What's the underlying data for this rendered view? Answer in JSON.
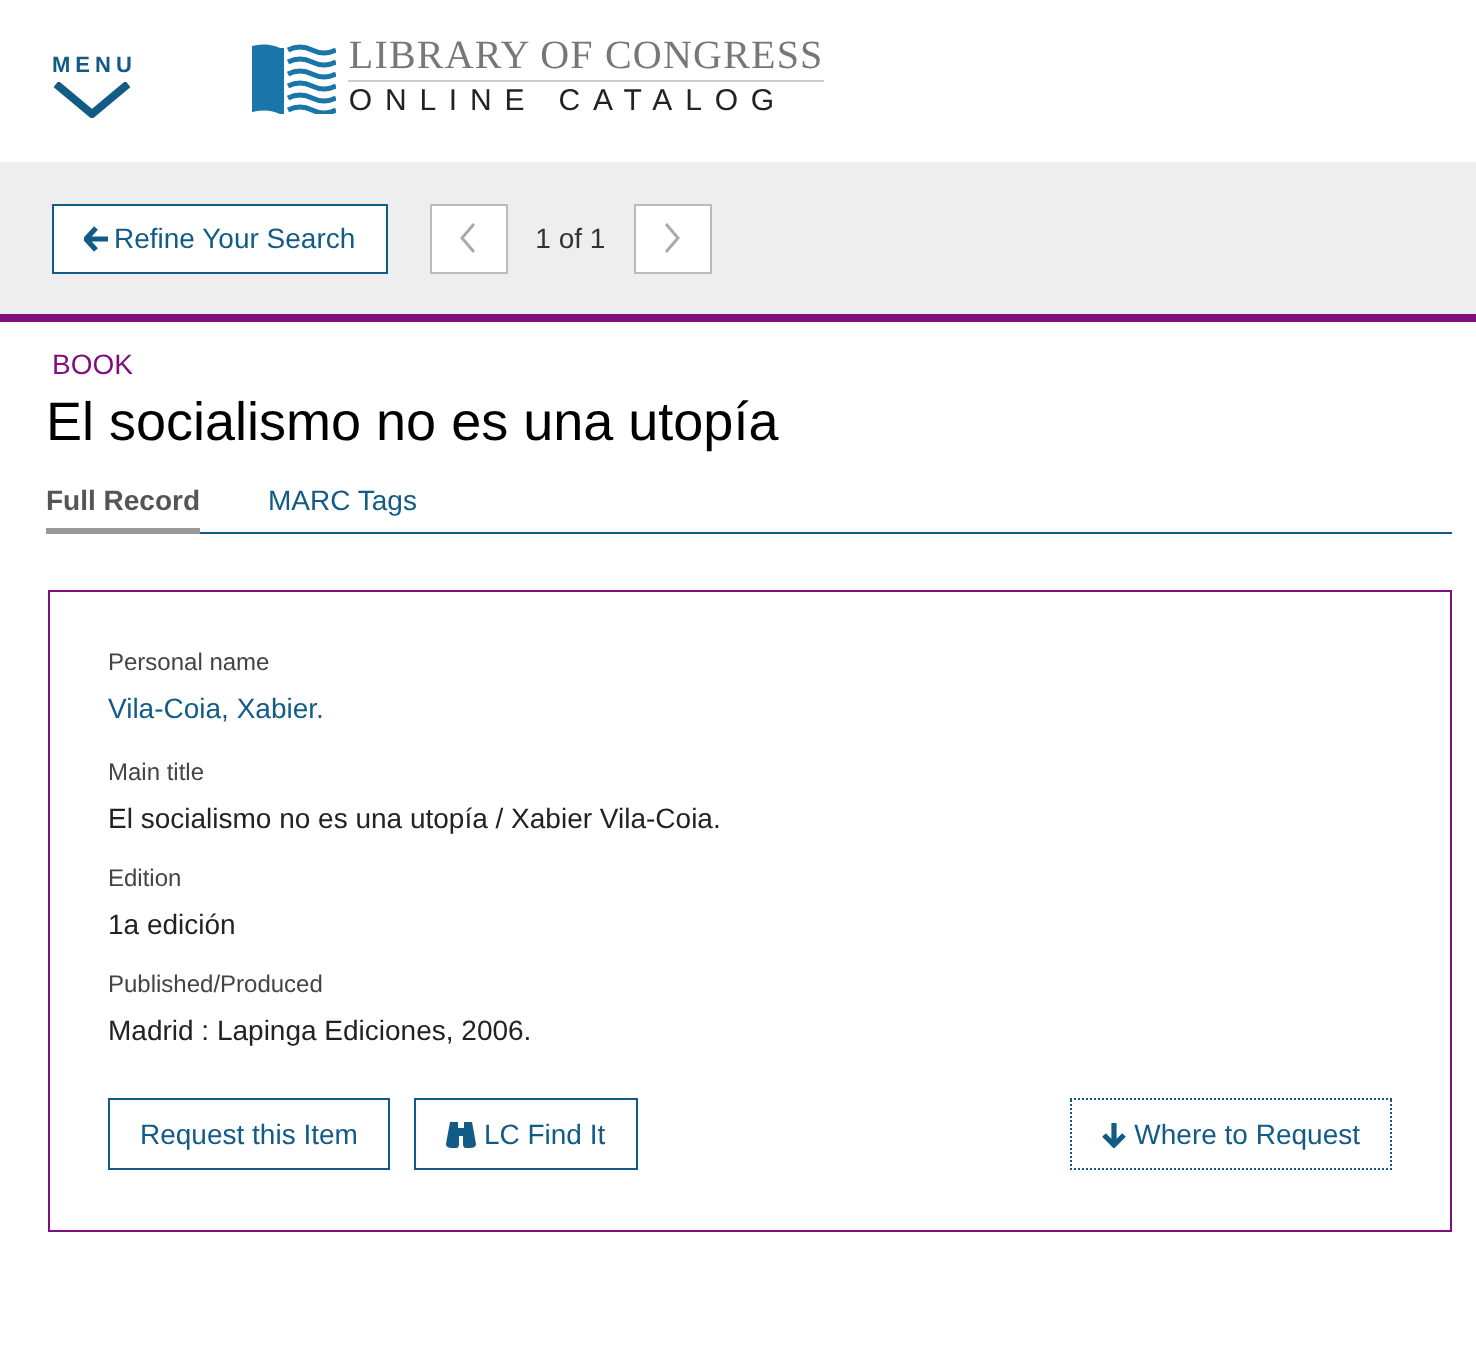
{
  "header": {
    "menu_label": "MENU",
    "logo_line1": "LIBRARY OF CONGRESS",
    "logo_line2": "ONLINE CATALOG"
  },
  "toolbar": {
    "refine_button": "Refine Your Search",
    "prev_disabled": true,
    "pager": "1 of 1",
    "next_disabled": true
  },
  "record": {
    "type_label": "BOOK",
    "title": "El socialismo no es una utopía"
  },
  "tabs": [
    {
      "label": "Full Record",
      "selected": true
    },
    {
      "label": "MARC Tags",
      "selected": false
    }
  ],
  "fields": [
    {
      "label": "Personal name",
      "value": "Vila-Coia, Xabier.",
      "kind": "link"
    },
    {
      "label": "Main title",
      "value": "El socialismo no es una utopía / Xabier Vila-Coia.",
      "kind": "text"
    },
    {
      "label": "Edition",
      "value": "1a edición",
      "kind": "text"
    },
    {
      "label": "Published/Produced",
      "value": "Madrid : Lapinga Ediciones, 2006.",
      "kind": "text"
    }
  ],
  "actions": [
    {
      "label": "Request this Item",
      "kind": "plain"
    },
    {
      "label": "LC Find It",
      "kind": "binoculars"
    },
    {
      "label": "Where to Request",
      "kind": "down"
    }
  ]
}
